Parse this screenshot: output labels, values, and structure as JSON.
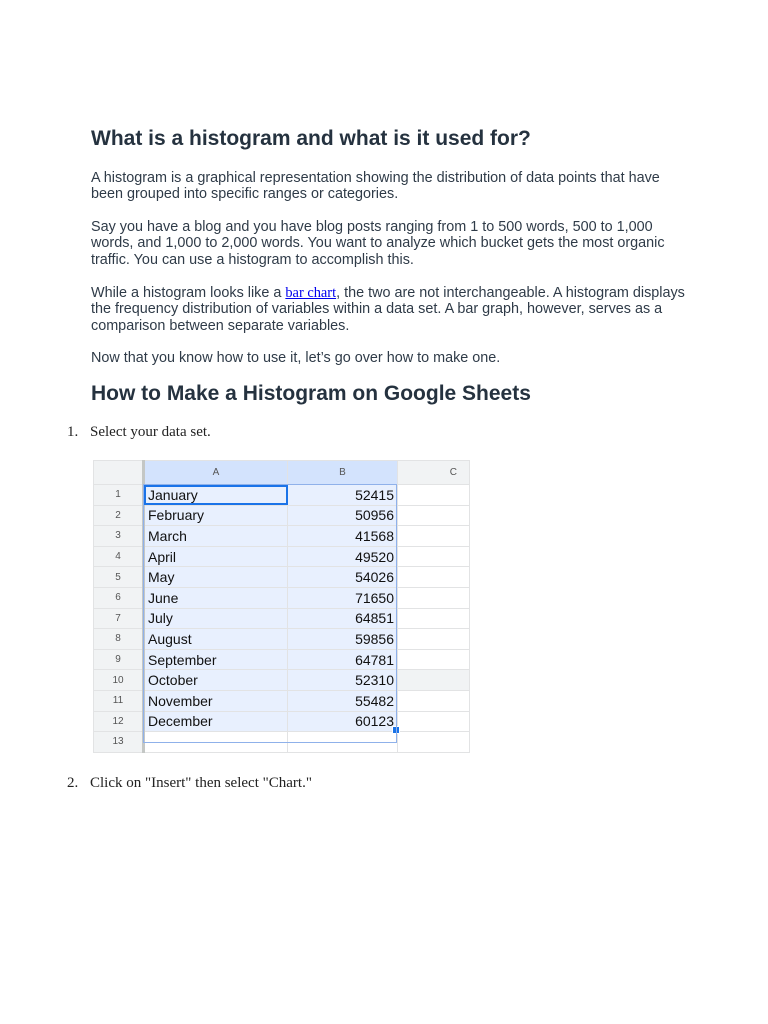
{
  "heading1": "What is a histogram and what is it used for?",
  "para1": "A histogram is a graphical representation showing the distribution of data points that have been grouped into specific ranges or categories.",
  "para2": "Say you have a blog and you have blog posts ranging from 1 to 500 words, 500 to 1,000 words, and 1,000 to 2,000 words. You want to analyze which bucket gets the most organic traffic. You can use a histogram to accomplish this.",
  "para3": {
    "before": "While a histogram looks like a ",
    "link": "bar chart",
    "after": ", the two are not interchangeable. A histogram displays the frequency distribution of variables within a data set. A bar graph, however, serves as a comparison between separate variables."
  },
  "para4": "Now that you know how to use it, let’s go over how to make one.",
  "heading2": "How to Make a Histogram on Google Sheets",
  "steps": [
    {
      "num": "1.",
      "text": "Select your data set."
    },
    {
      "num": "2.",
      "text": "Click on \"Insert\" then select \"Chart.\""
    }
  ],
  "sheet": {
    "columns": [
      "A",
      "B",
      "C"
    ],
    "rows": [
      {
        "n": "1",
        "a": "January",
        "b": "52415"
      },
      {
        "n": "2",
        "a": "February",
        "b": "50956"
      },
      {
        "n": "3",
        "a": "March",
        "b": "41568"
      },
      {
        "n": "4",
        "a": "April",
        "b": "49520"
      },
      {
        "n": "5",
        "a": "May",
        "b": "54026"
      },
      {
        "n": "6",
        "a": "June",
        "b": "71650"
      },
      {
        "n": "7",
        "a": "July",
        "b": "64851"
      },
      {
        "n": "8",
        "a": "August",
        "b": "59856"
      },
      {
        "n": "9",
        "a": "September",
        "b": "64781"
      },
      {
        "n": "10",
        "a": "October",
        "b": "52310"
      },
      {
        "n": "11",
        "a": "November",
        "b": "55482"
      },
      {
        "n": "12",
        "a": "December",
        "b": "60123"
      },
      {
        "n": "13",
        "a": "",
        "b": ""
      }
    ]
  }
}
